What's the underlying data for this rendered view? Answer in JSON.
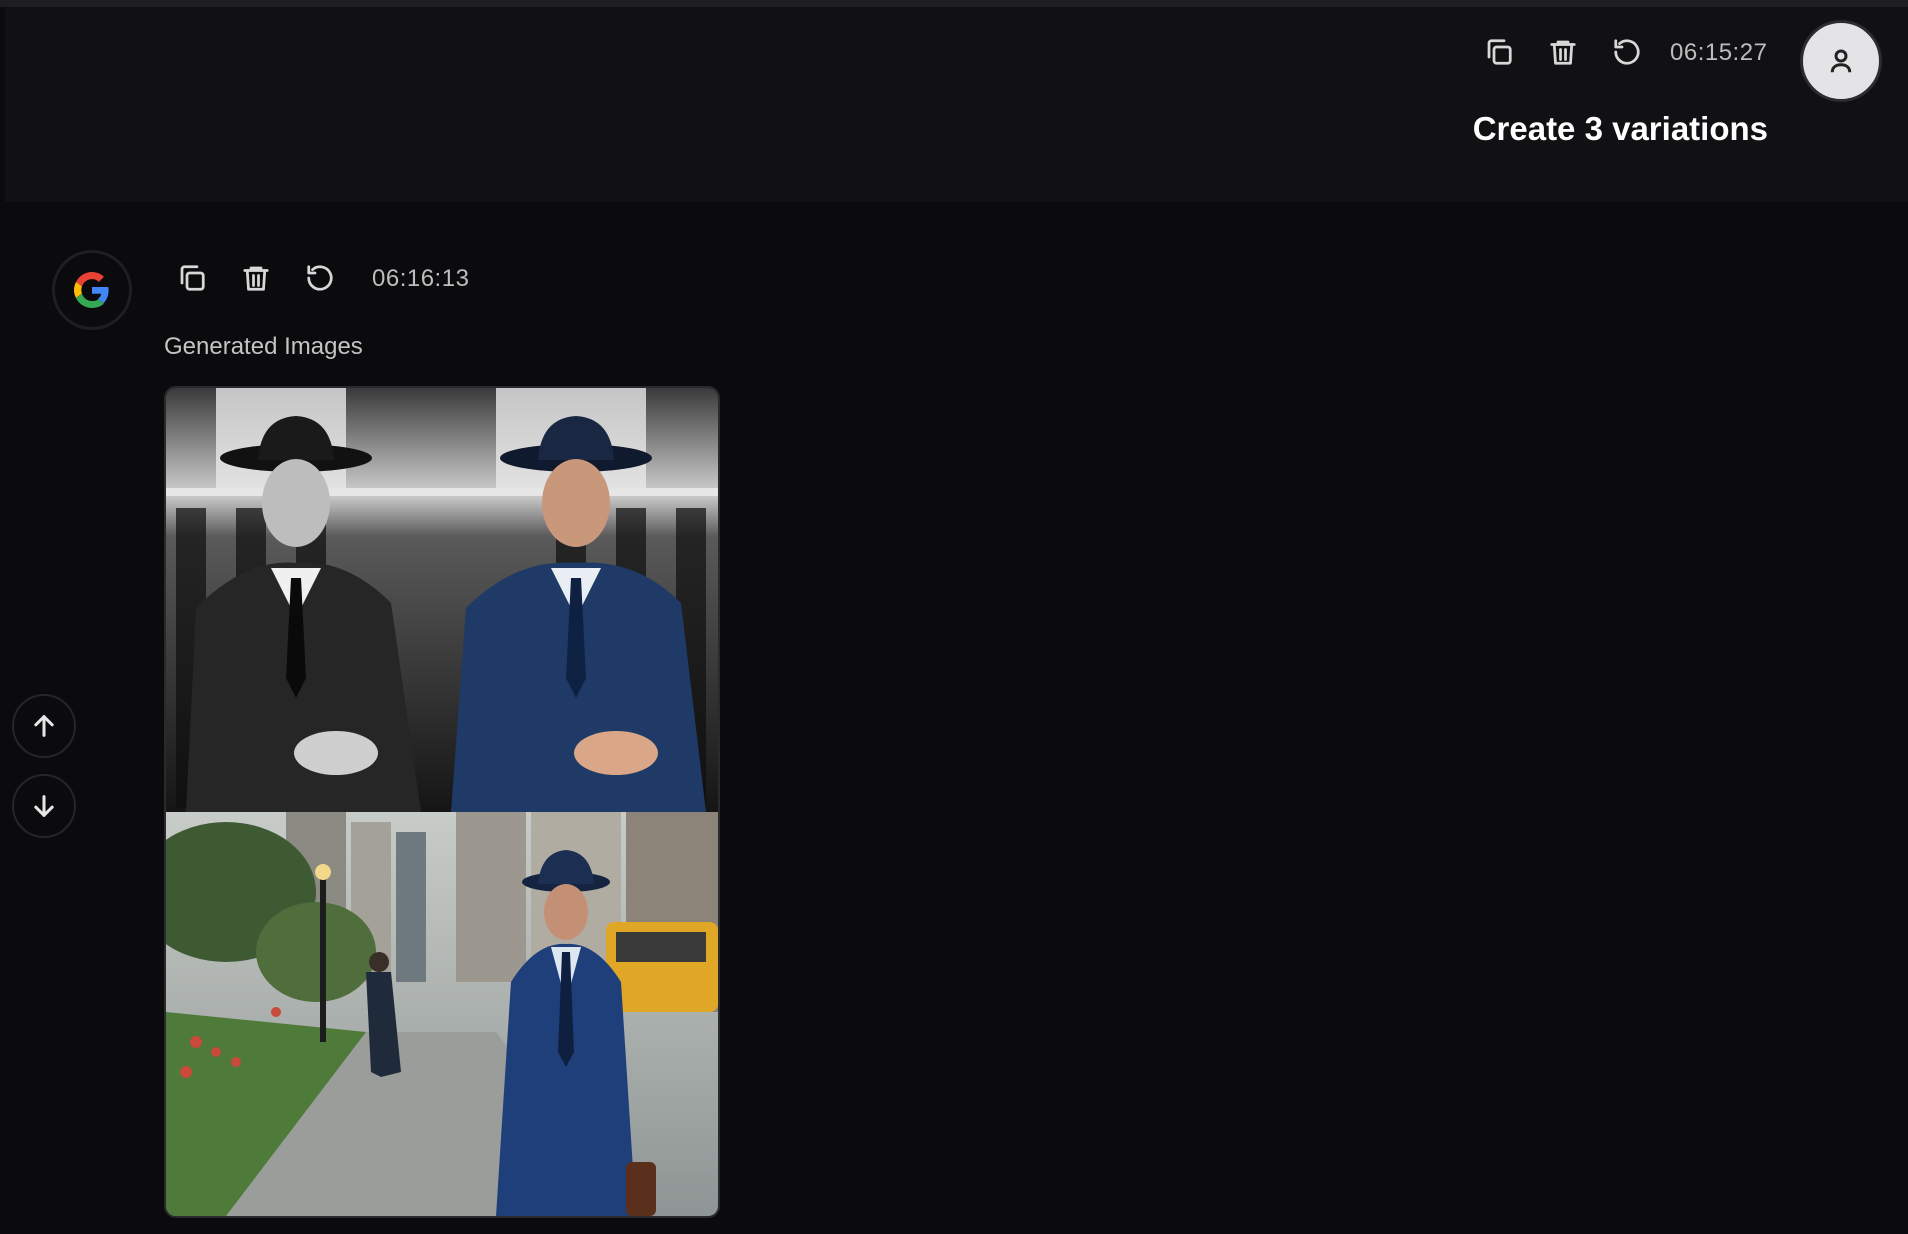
{
  "user_message": {
    "timestamp": "06:15:27",
    "text": "Create 3 variations",
    "actions": [
      "copy-icon",
      "trash-icon",
      "refresh-icon"
    ]
  },
  "bot_message": {
    "timestamp": "06:16:13",
    "section_label": "Generated Images",
    "actions": [
      "copy-icon",
      "trash-icon",
      "refresh-icon"
    ],
    "avatar": "google-logo-icon"
  },
  "scroll_controls": [
    "arrow-up-icon",
    "arrow-down-icon"
  ],
  "colors": {
    "background": "#0b0b0d",
    "user_message_bg": "#111114",
    "google_blue": "#4285F4",
    "google_red": "#EA4335",
    "google_yellow": "#FBBC05",
    "google_green": "#34A853"
  }
}
